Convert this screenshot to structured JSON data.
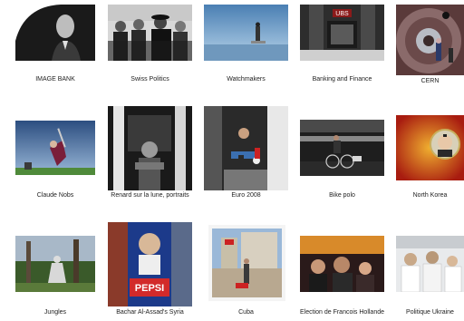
{
  "gallery": {
    "items": [
      {
        "label": "IMAGE BANK"
      },
      {
        "label": "Swiss Politics"
      },
      {
        "label": "Watchmakers"
      },
      {
        "label": "Banking and Finance"
      },
      {
        "label": "CERN"
      },
      {
        "label": "Claude Nobs"
      },
      {
        "label": "Renard sur la lune, portraits"
      },
      {
        "label": "Euro 2008"
      },
      {
        "label": "Bike polo"
      },
      {
        "label": "North Korea"
      },
      {
        "label": "Jungles"
      },
      {
        "label": "Bachar Al-Assad's Syria"
      },
      {
        "label": "Cuba"
      },
      {
        "label": "Election de Francois Hollande"
      },
      {
        "label": "Politique Ukraine"
      }
    ],
    "thumbnail_texts": {
      "banking_sign": "UBS",
      "pepsi_text": "PEPSI"
    }
  }
}
